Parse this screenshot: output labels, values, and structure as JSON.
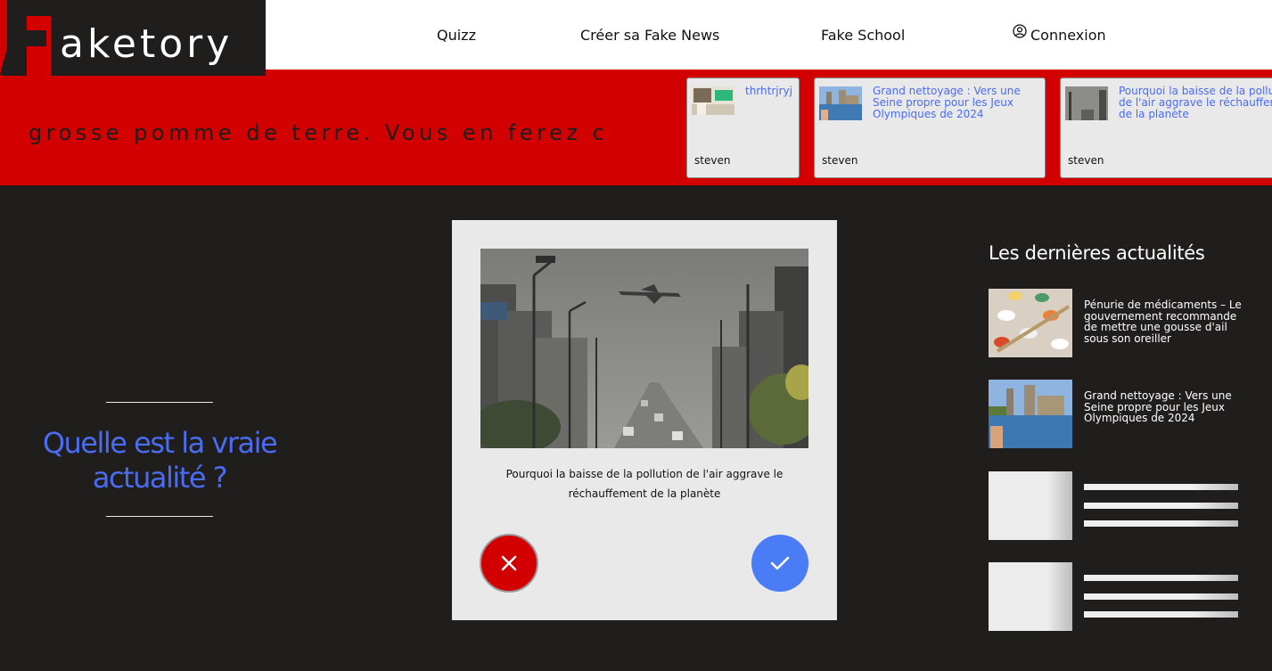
{
  "brand": {
    "logo_text": "aketory"
  },
  "nav": {
    "quizz": "Quizz",
    "create": "Créer sa Fake News",
    "school": "Fake School",
    "login": "Connexion"
  },
  "ticker": {
    "marquee_text": "grosse pomme de terre. Vous en ferez ce q",
    "cards": [
      {
        "title": "thrhtrjryj",
        "author": "steven"
      },
      {
        "title": "Grand nettoyage : Vers une Seine propre pour les Jeux Olympiques de 2024",
        "author": "steven"
      },
      {
        "title_line1": "Pourquoi la baisse de la pollu",
        "title_line2": "de l'air aggrave le réchauffem",
        "title_line3": "de la planète",
        "author": "steven"
      }
    ]
  },
  "quiz": {
    "heading_line1": "Quelle est la vraie",
    "heading_line2": "actualité ?",
    "caption": "Pourquoi la baisse de la pollution de l'air aggrave le réchauffement de la planète"
  },
  "news": {
    "heading": "Les dernières actualités",
    "items": [
      {
        "title": "Pénurie de médicaments – Le gouvernement recommande de mettre une gousse d'ail sous son oreiller"
      },
      {
        "title": "Grand nettoyage : Vers une Seine propre pour les Jeux Olympiques de 2024"
      }
    ]
  },
  "colors": {
    "brand_red": "#d20000",
    "accent_blue": "#4a6cf0",
    "background_dark": "#201d1d",
    "card_gray": "#e9e9e9"
  },
  "icons": {
    "user": "user-circle-icon",
    "false_button": "close-icon",
    "true_button": "check-icon"
  }
}
